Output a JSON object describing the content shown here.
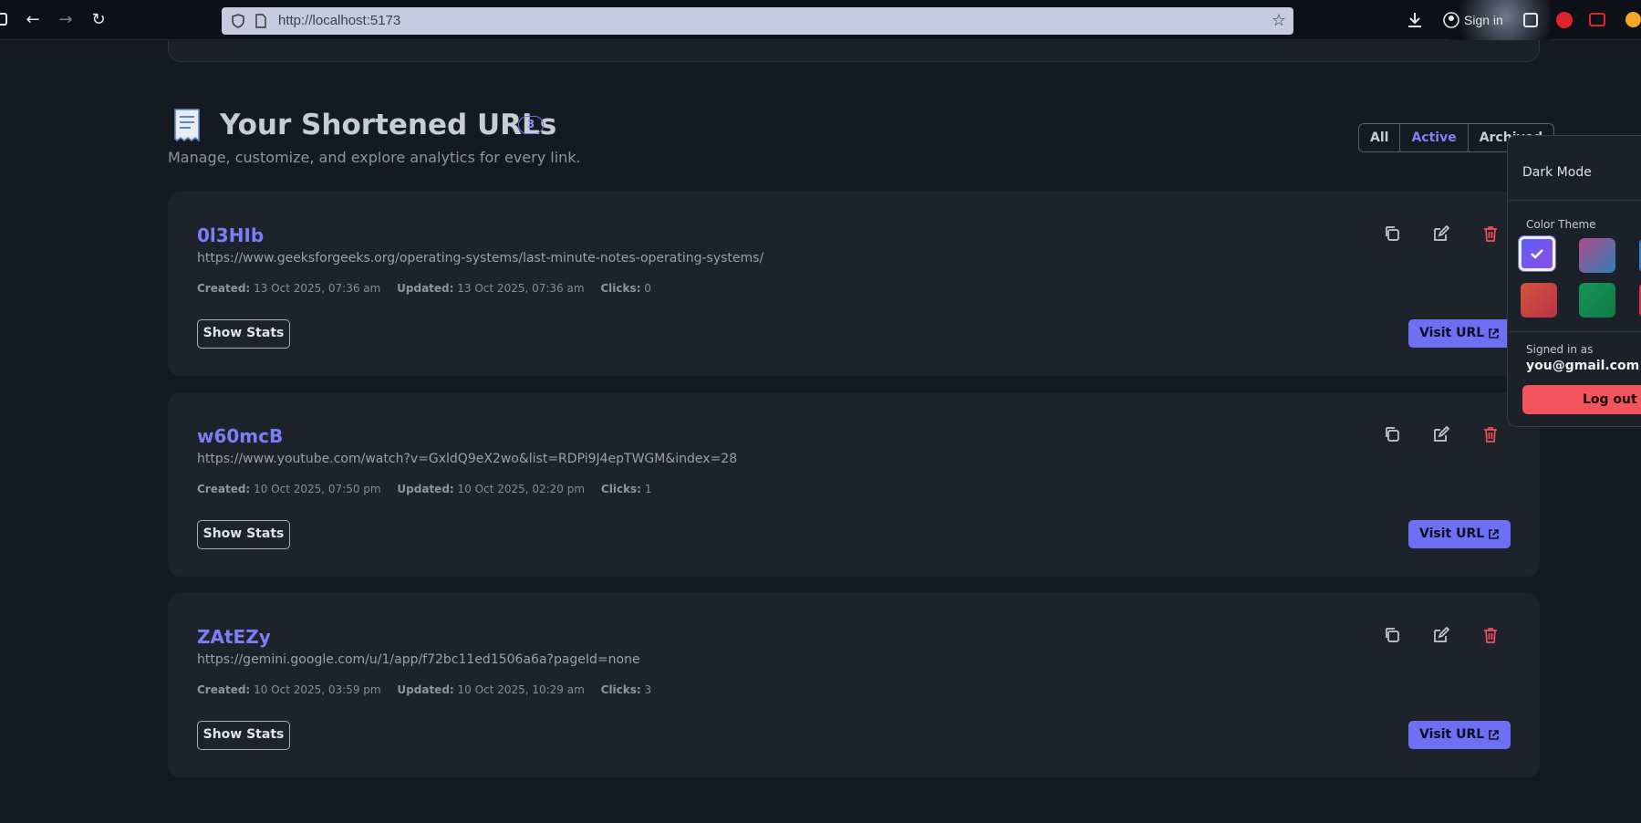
{
  "browser": {
    "url": "http://localhost:5173",
    "sign_in_label": "Sign in"
  },
  "header": {
    "icon": "receipt-icon",
    "title": "Your Shortened URLs",
    "count": "3",
    "subtitle": "Manage, customize, and explore analytics for every link."
  },
  "filters": {
    "items": [
      {
        "label": "All",
        "active": false
      },
      {
        "label": "Active",
        "active": true
      },
      {
        "label": "Archived",
        "active": false
      }
    ]
  },
  "labels": {
    "created": "Created:",
    "updated": "Updated:",
    "clicks": "Clicks:",
    "show_stats": "Show Stats",
    "visit_url": "Visit URL"
  },
  "links": [
    {
      "code": "0l3HIb",
      "url": "https://www.geeksforgeeks.org/operating-systems/last-minute-notes-operating-systems/",
      "created": "13 Oct 2025, 07:36 am",
      "updated": "13 Oct 2025, 07:36 am",
      "clicks": "0"
    },
    {
      "code": "w60mcB",
      "url": "https://www.youtube.com/watch?v=GxldQ9eX2wo&list=RDPi9J4epTWGM&index=28",
      "created": "10 Oct 2025, 07:50 pm",
      "updated": "10 Oct 2025, 02:20 pm",
      "clicks": "1"
    },
    {
      "code": "ZAtEZy",
      "url": "https://gemini.google.com/u/1/app/f72bc11ed1506a6a?pageId=none",
      "created": "10 Oct 2025, 03:59 pm",
      "updated": "10 Oct 2025, 10:29 am",
      "clicks": "3"
    }
  ],
  "settings": {
    "dark_mode_label": "Dark Mode",
    "color_theme_label": "Color Theme",
    "themes": [
      "#5b5ff0",
      "#b04a8c",
      "#c9433d",
      "#17935a"
    ],
    "signed_in_label": "Signed in as",
    "email": "you@gmail.com",
    "logout_label": "Log out"
  },
  "colors": {
    "accent": "#6d70f4",
    "danger": "#f2545e",
    "background": "#151a22",
    "card": "#1d222b"
  }
}
